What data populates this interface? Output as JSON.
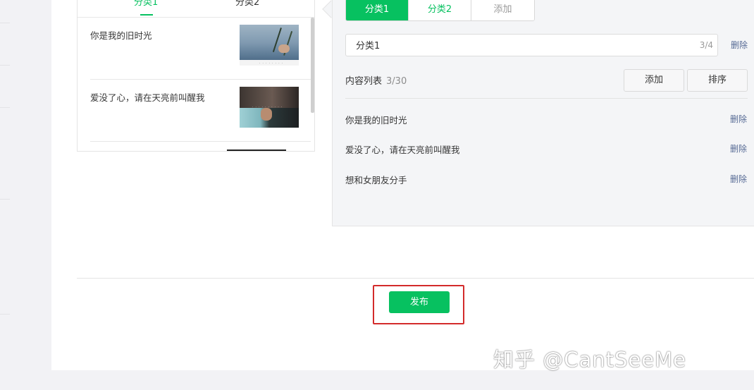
{
  "preview": {
    "tabs": [
      "分类1",
      "分类2"
    ],
    "items": [
      {
        "title": "你是我的旧时光",
        "thumb_caption": "· · · · · · · ·"
      },
      {
        "title": "爱没了心，请在天亮前叫醒我",
        "thumb_caption": "· · · · · · · · · ·"
      }
    ]
  },
  "editor": {
    "tabs": [
      "分类1",
      "分类2",
      "添加"
    ],
    "name_value": "分类1",
    "name_count": "3/4",
    "delete_label": "删除",
    "list_label": "内容列表",
    "list_count": "3/30",
    "add_button": "添加",
    "sort_button": "排序",
    "rows": [
      {
        "title": "你是我的旧时光",
        "action": "删除"
      },
      {
        "title": "爱没了心，请在天亮前叫醒我",
        "action": "删除"
      },
      {
        "title": "想和女朋友分手",
        "action": "删除"
      }
    ]
  },
  "publish_label": "发布",
  "watermark": "知乎 @CantSeeMe",
  "colors": {
    "accent": "#07c160",
    "link": "#576b95",
    "highlight": "#d32b2b"
  }
}
